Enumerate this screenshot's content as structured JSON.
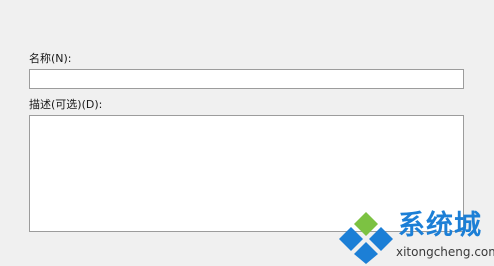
{
  "form": {
    "name_label": "名称(N):",
    "name_value": "",
    "description_label": "描述(可选)(D):",
    "description_value": ""
  },
  "watermark": {
    "brand": "系统城",
    "url": "xitongcheng.com",
    "icon": "diamond-logo-icon",
    "colors": {
      "green": "#7cc242",
      "blue": "#1c7fd6"
    }
  },
  "colors": {
    "background": "#f0f0f0",
    "field_border": "#9c9c9c"
  }
}
